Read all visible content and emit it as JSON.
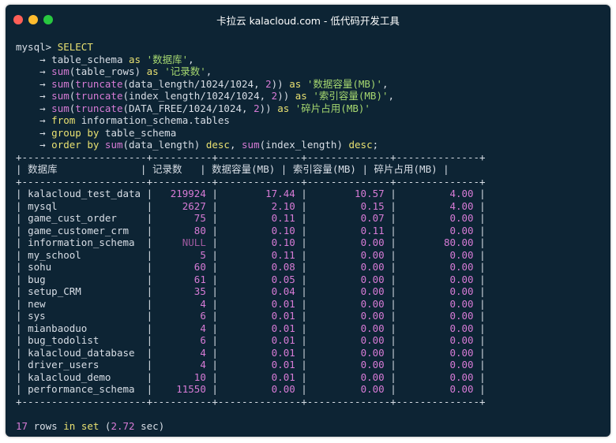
{
  "window": {
    "title": "卡拉云 kalacloud.com - 低代码开发工具",
    "colors": {
      "background": "#0d2434",
      "close": "#ff5f57",
      "minimize": "#febc2e",
      "maximize": "#28c840"
    }
  },
  "query": {
    "prompt": "mysql>",
    "continuation": "→",
    "lines": [
      [
        {
          "t": "SELECT",
          "c": "kw"
        }
      ],
      [
        {
          "t": "table_schema ",
          "c": ""
        },
        {
          "t": "as",
          "c": "kw"
        },
        {
          "t": " ",
          "c": ""
        },
        {
          "t": "'数据库'",
          "c": "str"
        },
        {
          "t": ",",
          "c": ""
        }
      ],
      [
        {
          "t": "sum",
          "c": "fn"
        },
        {
          "t": "(table_rows) ",
          "c": ""
        },
        {
          "t": "as",
          "c": "kw"
        },
        {
          "t": " ",
          "c": ""
        },
        {
          "t": "'记录数'",
          "c": "str"
        },
        {
          "t": ",",
          "c": ""
        }
      ],
      [
        {
          "t": "sum",
          "c": "fn"
        },
        {
          "t": "(",
          "c": ""
        },
        {
          "t": "truncate",
          "c": "fn"
        },
        {
          "t": "(data_length/1024/1024, ",
          "c": ""
        },
        {
          "t": "2",
          "c": "num"
        },
        {
          "t": ")) ",
          "c": ""
        },
        {
          "t": "as",
          "c": "kw"
        },
        {
          "t": " ",
          "c": ""
        },
        {
          "t": "'数据容量(MB)'",
          "c": "str"
        },
        {
          "t": ",",
          "c": ""
        }
      ],
      [
        {
          "t": "sum",
          "c": "fn"
        },
        {
          "t": "(",
          "c": ""
        },
        {
          "t": "truncate",
          "c": "fn"
        },
        {
          "t": "(index_length/1024/1024, ",
          "c": ""
        },
        {
          "t": "2",
          "c": "num"
        },
        {
          "t": ")) ",
          "c": ""
        },
        {
          "t": "as",
          "c": "kw"
        },
        {
          "t": " ",
          "c": ""
        },
        {
          "t": "'索引容量(MB)'",
          "c": "str"
        },
        {
          "t": ",",
          "c": ""
        }
      ],
      [
        {
          "t": "sum",
          "c": "fn"
        },
        {
          "t": "(",
          "c": ""
        },
        {
          "t": "truncate",
          "c": "fn"
        },
        {
          "t": "(DATA_FREE/1024/1024, ",
          "c": ""
        },
        {
          "t": "2",
          "c": "num"
        },
        {
          "t": ")) ",
          "c": ""
        },
        {
          "t": "as",
          "c": "kw"
        },
        {
          "t": " ",
          "c": ""
        },
        {
          "t": "'碎片占用(MB)'",
          "c": "str"
        }
      ],
      [
        {
          "t": "from",
          "c": "kw"
        },
        {
          "t": " information_schema.tables",
          "c": ""
        }
      ],
      [
        {
          "t": "group by",
          "c": "kw"
        },
        {
          "t": " table_schema",
          "c": ""
        }
      ],
      [
        {
          "t": "order by",
          "c": "kw"
        },
        {
          "t": " ",
          "c": ""
        },
        {
          "t": "sum",
          "c": "fn"
        },
        {
          "t": "(data_length) ",
          "c": ""
        },
        {
          "t": "desc",
          "c": "kw"
        },
        {
          "t": ", ",
          "c": ""
        },
        {
          "t": "sum",
          "c": "fn"
        },
        {
          "t": "(index_length) ",
          "c": ""
        },
        {
          "t": "desc",
          "c": "kw"
        },
        {
          "t": ";",
          "c": ""
        }
      ]
    ]
  },
  "table": {
    "headers": [
      "数据库",
      "记录数",
      "数据容量(MB)",
      "索引容量(MB)",
      "碎片占用(MB)"
    ],
    "rows": [
      [
        "kalacloud_test_data",
        "219924",
        "17.44",
        "10.57",
        "4.00"
      ],
      [
        "mysql",
        "2627",
        "2.10",
        "0.15",
        "4.00"
      ],
      [
        "game_cust_order",
        "75",
        "0.11",
        "0.07",
        "0.00"
      ],
      [
        "game_customer_crm",
        "80",
        "0.10",
        "0.11",
        "0.00"
      ],
      [
        "information_schema",
        "NULL",
        "0.10",
        "0.00",
        "80.00"
      ],
      [
        "my_school",
        "5",
        "0.11",
        "0.00",
        "0.00"
      ],
      [
        "sohu",
        "60",
        "0.08",
        "0.00",
        "0.00"
      ],
      [
        "bug",
        "61",
        "0.05",
        "0.00",
        "0.00"
      ],
      [
        "setup_CRM",
        "35",
        "0.04",
        "0.00",
        "0.00"
      ],
      [
        "new",
        "4",
        "0.01",
        "0.00",
        "0.00"
      ],
      [
        "sys",
        "6",
        "0.01",
        "0.00",
        "0.00"
      ],
      [
        "mianbaoduo",
        "4",
        "0.01",
        "0.00",
        "0.00"
      ],
      [
        "bug_todolist",
        "6",
        "0.01",
        "0.00",
        "0.00"
      ],
      [
        "kalacloud_database",
        "4",
        "0.01",
        "0.00",
        "0.00"
      ],
      [
        "driver_users",
        "4",
        "0.01",
        "0.00",
        "0.00"
      ],
      [
        "kalacloud_demo",
        "10",
        "0.01",
        "0.00",
        "0.00"
      ],
      [
        "performance_schema",
        "11550",
        "0.00",
        "0.00",
        "0.00"
      ]
    ]
  },
  "footer": {
    "count": "17",
    "rows_word": "rows",
    "in_word": "in",
    "set_word": "set",
    "time": "2.72",
    "unit": "sec"
  }
}
